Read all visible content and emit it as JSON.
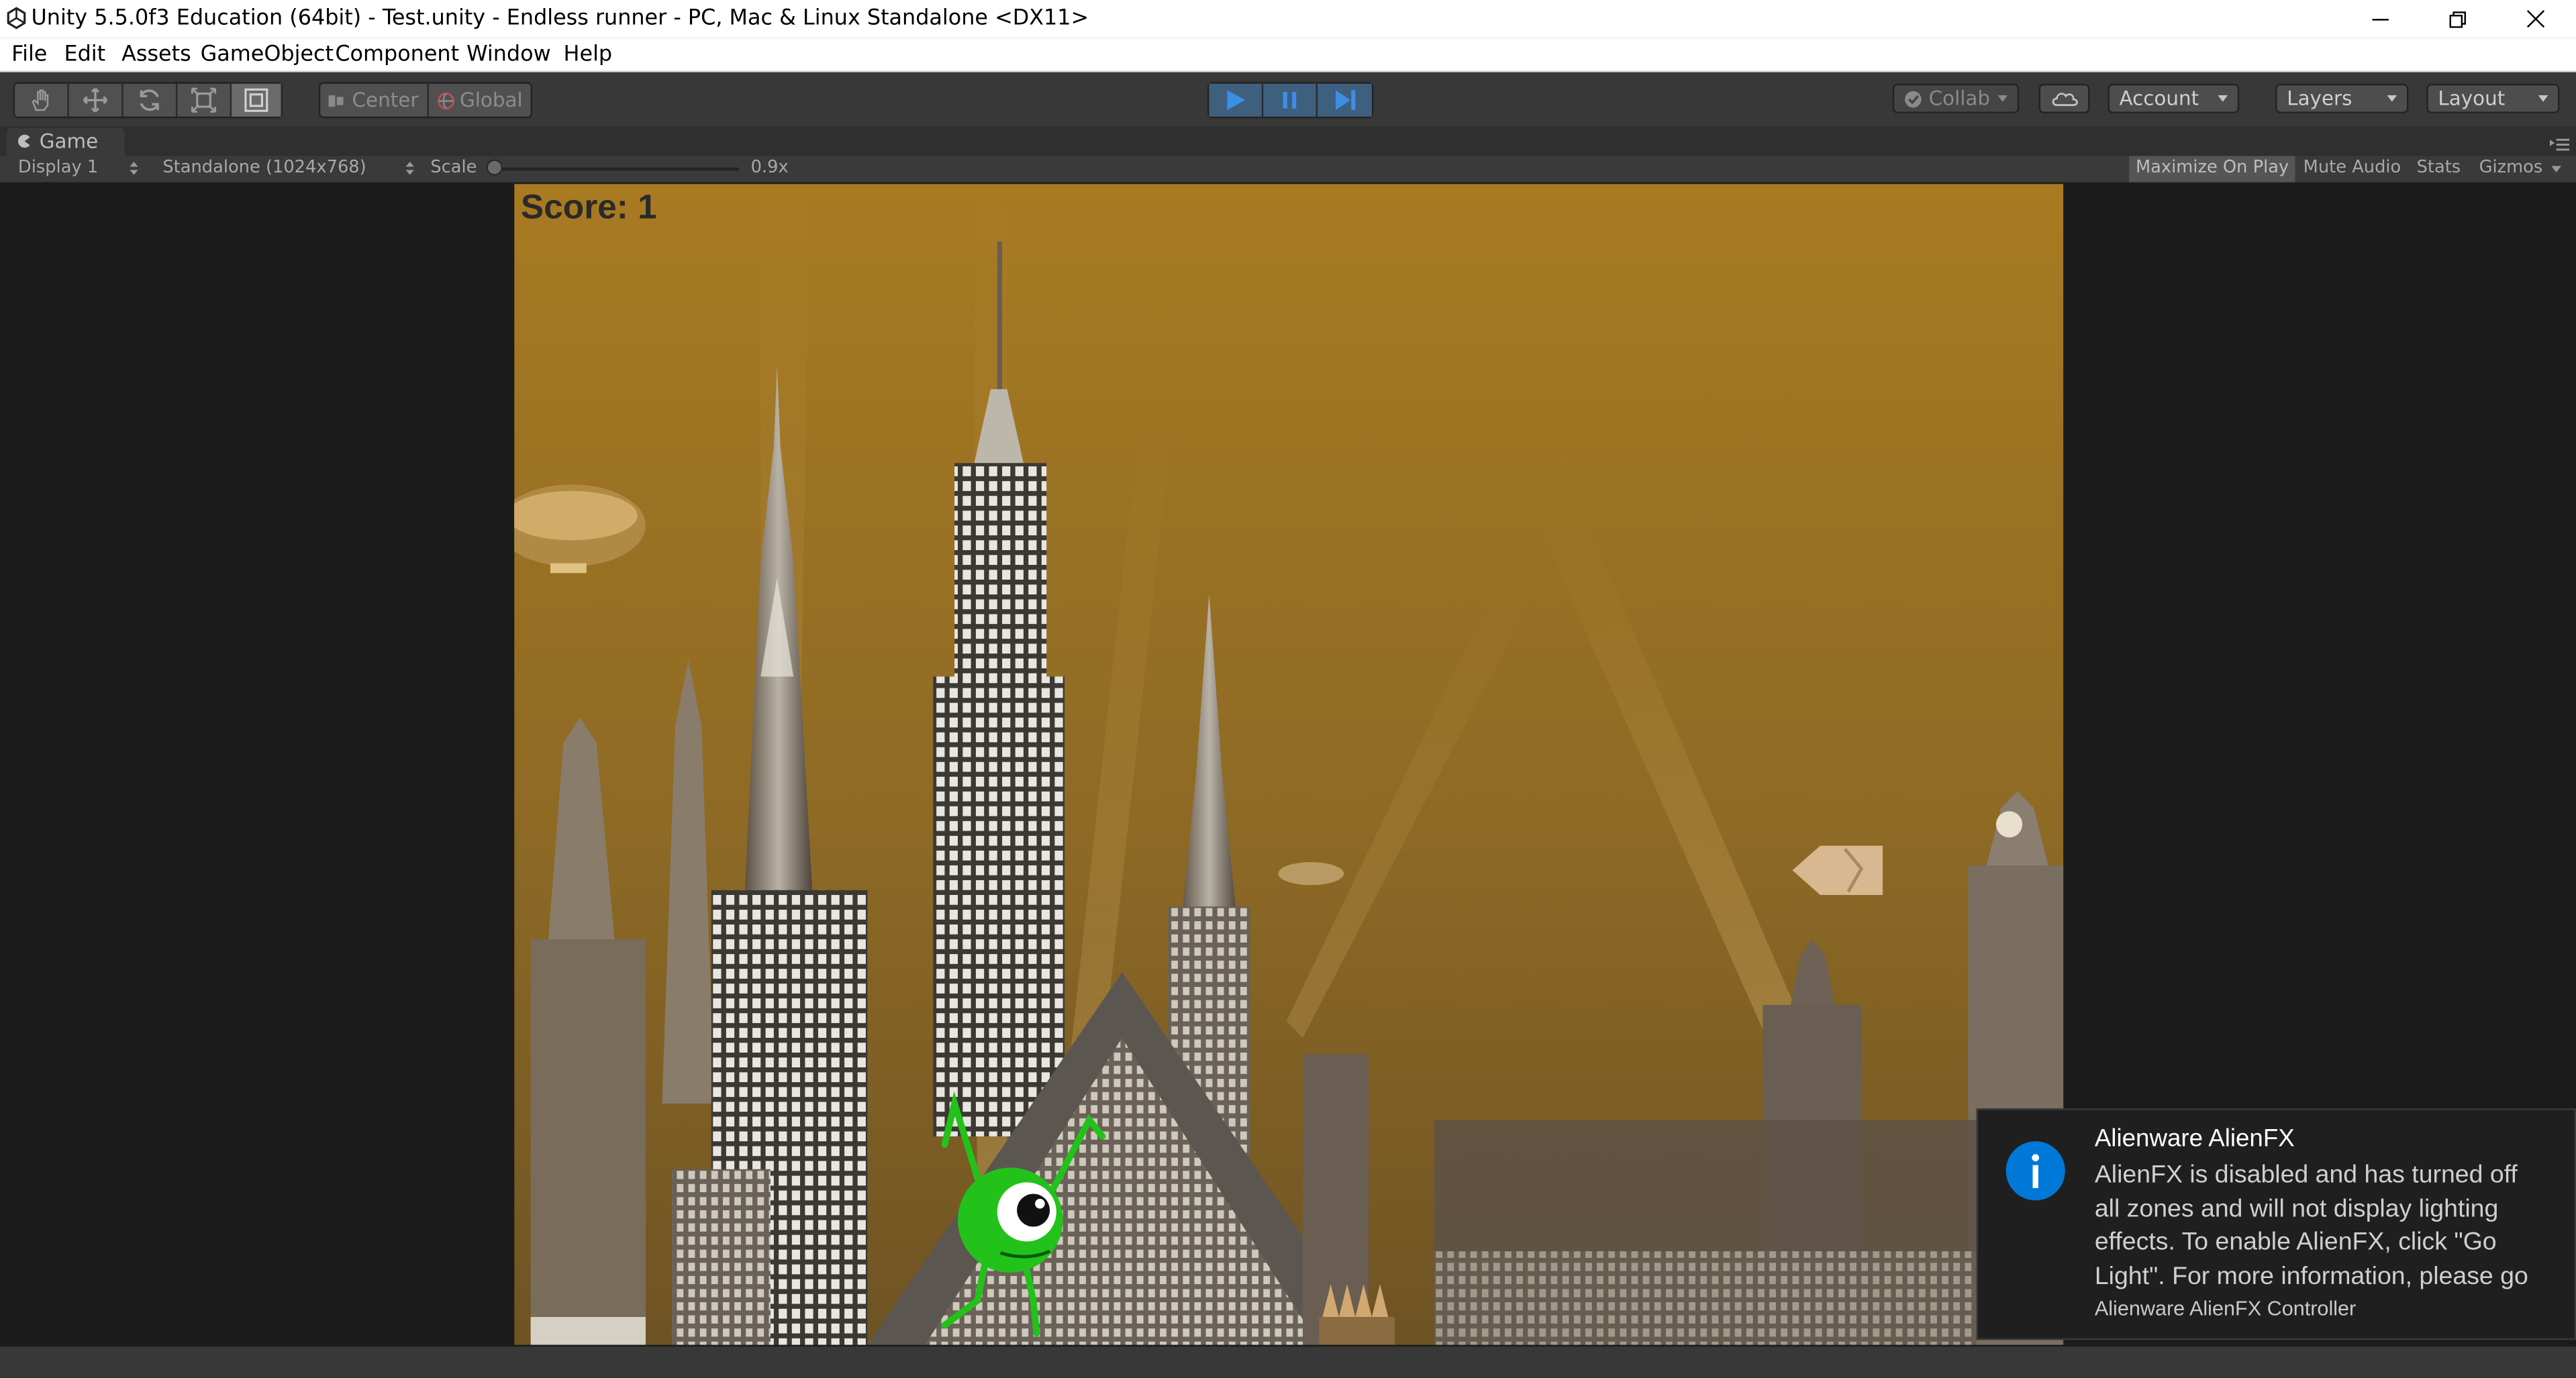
{
  "window": {
    "title": "Unity 5.5.0f3 Education (64bit) - Test.unity - Endless runner - PC, Mac & Linux Standalone <DX11>",
    "controls": [
      "minimize-icon",
      "restore-icon",
      "close-icon"
    ]
  },
  "menu": [
    "File",
    "Edit",
    "Assets",
    "GameObject",
    "Component",
    "Window",
    "Help"
  ],
  "toolbar": {
    "transform_tools": [
      "hand-icon",
      "move-icon",
      "rotate-icon",
      "scale-icon",
      "rect-tool-icon"
    ],
    "active_tool": "rect-tool-icon",
    "pivot": "Center",
    "space": "Global",
    "play_controls": [
      "play-icon",
      "pause-icon",
      "step-icon"
    ],
    "playing": true,
    "collab_label": "Collab",
    "account_label": "Account",
    "layers_label": "Layers",
    "layout_label": "Layout"
  },
  "game_tab": {
    "label": "Game"
  },
  "game_bar": {
    "display": "Display 1",
    "resolution": "Standalone (1024x768)",
    "scale_label": "Scale",
    "scale_value": "0.9x",
    "maximize_on_play": "Maximize On Play",
    "mute_audio": "Mute Audio",
    "stats": "Stats",
    "gizmos": "Gizmos",
    "maximize_on_play_enabled": true
  },
  "game": {
    "score_text": "Score: 1",
    "sky_color_top": "#a87a22",
    "sky_color_bottom": "#7a5a20",
    "player_color": "#22c21a"
  },
  "notification": {
    "title": "Alienware AlienFX",
    "body": "AlienFX is disabled and has turned off all zones and will not display lighting effects. To enable AlienFX, click \"Go Light\". For more information, please go",
    "source": "Alienware AlienFX Controller",
    "icon": "info-icon",
    "accent": "#0078d7"
  }
}
